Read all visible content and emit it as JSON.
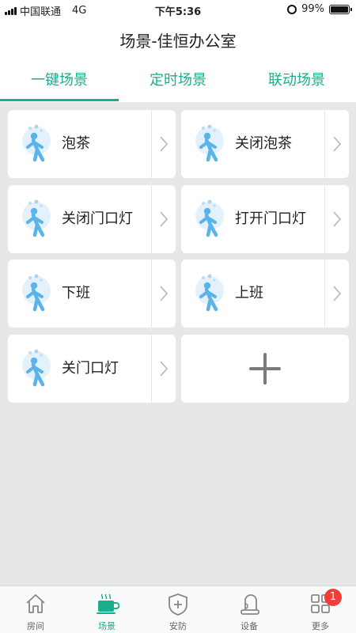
{
  "status_bar": {
    "carrier": "中国联通",
    "network": "4G",
    "time": "下午5:36",
    "battery": "99%",
    "battery_level": 0.99
  },
  "header": {
    "title": "场景-佳恒办公室"
  },
  "tabs": [
    {
      "label": "一键场景",
      "active": true
    },
    {
      "label": "定时场景",
      "active": false
    },
    {
      "label": "联动场景",
      "active": false
    }
  ],
  "scenes": [
    {
      "label": "泡茶"
    },
    {
      "label": "关闭泡茶"
    },
    {
      "label": "关闭门口灯"
    },
    {
      "label": "打开门口灯"
    },
    {
      "label": "下班"
    },
    {
      "label": "上班"
    },
    {
      "label": "关门口灯"
    }
  ],
  "add_scene": {
    "icon": "plus-icon"
  },
  "bottom_nav": [
    {
      "label": "房间",
      "icon": "house-icon",
      "active": false
    },
    {
      "label": "场景",
      "icon": "coffee-cup-icon",
      "active": true
    },
    {
      "label": "安防",
      "icon": "shield-icon",
      "active": false
    },
    {
      "label": "设备",
      "icon": "device-icon",
      "active": false
    },
    {
      "label": "更多",
      "icon": "grid-icon",
      "active": false,
      "badge": "1"
    }
  ],
  "colors": {
    "accent": "#1aae8e",
    "background": "#e6e7e9",
    "badge": "#f23d3d",
    "icon_blue": "#5ab4ea"
  }
}
